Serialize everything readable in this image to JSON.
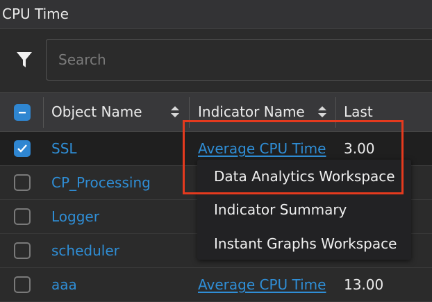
{
  "panel": {
    "title": "CPU Time"
  },
  "search": {
    "placeholder": "Search"
  },
  "columns": {
    "object_name": "Object Name",
    "indicator_name": "Indicator Name",
    "last": "Last"
  },
  "rows": [
    {
      "object": "SSL",
      "indicator": "Average CPU Time",
      "last": "3.00",
      "checked": true
    },
    {
      "object": "CP_Processing",
      "indicator": "",
      "last": "",
      "checked": false
    },
    {
      "object": "Logger",
      "indicator": "",
      "last": "",
      "checked": false
    },
    {
      "object": "scheduler",
      "indicator": "",
      "last": "",
      "checked": false
    },
    {
      "object": "aaa",
      "indicator": "Average CPU Time",
      "last": "13.00",
      "checked": false
    }
  ],
  "context_menu": {
    "items": [
      "Data Analytics Workspace",
      "Indicator Summary",
      "Instant Graphs Workspace"
    ]
  },
  "colors": {
    "accent": "#2f86d1",
    "link": "#2f8ed6",
    "highlight": "#e53a1e"
  },
  "icons": {
    "filter": "filter-icon",
    "sort": "sort-icon",
    "check": "check-icon",
    "minus": "minus-icon"
  }
}
